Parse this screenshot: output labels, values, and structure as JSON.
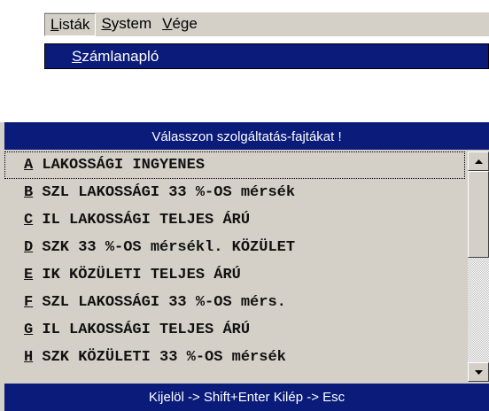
{
  "menu": {
    "items": [
      {
        "first": "L",
        "rest": "isták"
      },
      {
        "first": "S",
        "rest": "ystem"
      },
      {
        "first": "V",
        "rest": "ége"
      }
    ],
    "submenu": {
      "first": "S",
      "rest": "zámlanapló"
    }
  },
  "dialog": {
    "title": "Válasszon szolgáltatás-fajtákat !",
    "footer": "Kijelöl -> Shift+Enter   Kilép -> Esc",
    "items": [
      {
        "key": "A",
        "text": " LAKOSSÁGI INGYENES"
      },
      {
        "key": "B",
        "text": " SZL LAKOSSÁGI 33 %-OS mérsék"
      },
      {
        "key": "C",
        "text": " IL LAKOSSÁGI TELJES ÁRÚ"
      },
      {
        "key": "D",
        "text": " SZK 33 %-OS mérsékl. KÖZÜLET"
      },
      {
        "key": "E",
        "text": " IK KÖZÜLETI TELJES ÁRÚ"
      },
      {
        "key": "F",
        "text": " SZL LAKOSSÁGI 33 %-OS mérs."
      },
      {
        "key": "G",
        "text": " IL LAKOSSÁGI TELJES ÁRÚ"
      },
      {
        "key": "H",
        "text": " SZK KÖZÜLETI 33 %-OS mérsék"
      }
    ]
  },
  "colors": {
    "title_bar": "#0a1b7a",
    "face": "#d4d0c8",
    "text_on_bar": "#ffffff"
  }
}
